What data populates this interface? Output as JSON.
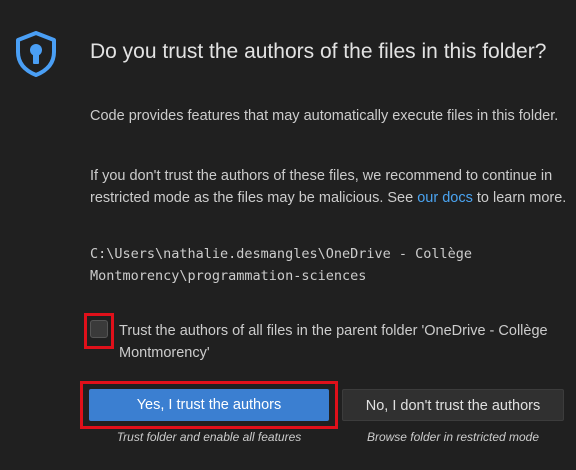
{
  "dialog": {
    "icon": "shield-lock-icon",
    "title": "Do you trust the authors of the files in this folder?",
    "paragraph1": "Code provides features that may automatically execute files in this folder.",
    "paragraph2_before_link": "If you don't trust the authors of these files, we recommend to continue in restricted mode as the files may be malicious. See ",
    "paragraph2_link": "our docs",
    "paragraph2_after_link": " to learn more.",
    "path": "C:\\Users\\nathalie.desmangles\\OneDrive - Collège Montmorency\\programmation-sciences",
    "checkbox_label": "Trust the authors of all files in the parent folder 'OneDrive - Collège Montmorency'",
    "checkbox_checked": false,
    "primary_button": "Yes, I trust the authors",
    "primary_caption": "Trust folder and enable all features",
    "secondary_button": "No, I don't trust the authors",
    "secondary_caption": "Browse folder in restricted mode"
  },
  "colors": {
    "background": "#202020",
    "accent": "#3b7fd1",
    "link": "#4aa3f0",
    "highlight": "#e0101a"
  }
}
